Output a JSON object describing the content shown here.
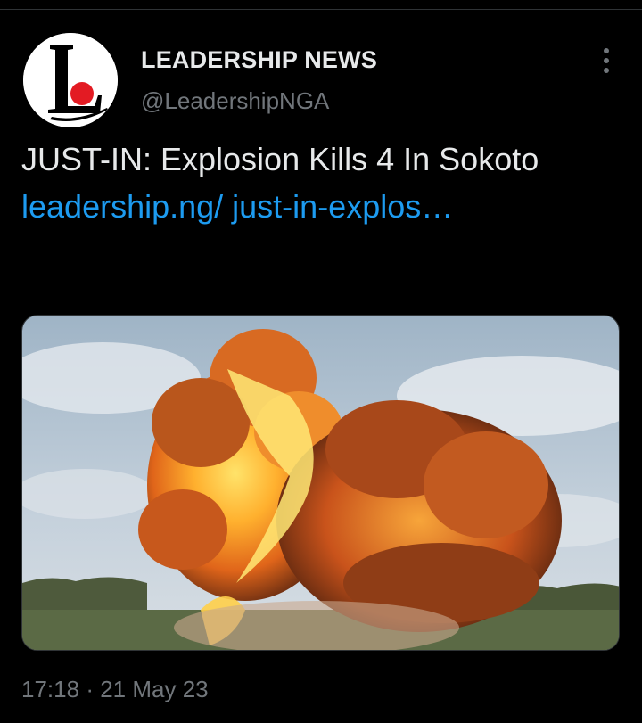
{
  "author": {
    "name": "LEADERSHIP NEWS",
    "handle": "@LeadershipNGA",
    "avatar_logo_letter": "L",
    "avatar_dot_color": "#e31b23"
  },
  "tweet": {
    "text": "JUST-IN: Explosion Kills 4 In Sokoto",
    "link_text": "leadership.ng/ just-in-explos…"
  },
  "media": {
    "icon": "explosion-photo"
  },
  "meta": {
    "time": "17:18",
    "separator": "·",
    "date": "21 May 23"
  },
  "colors": {
    "background": "#000000",
    "text": "#e7e9ea",
    "muted": "#71767b",
    "link": "#1d9bf0"
  },
  "more_icon": "more-vertical-icon"
}
